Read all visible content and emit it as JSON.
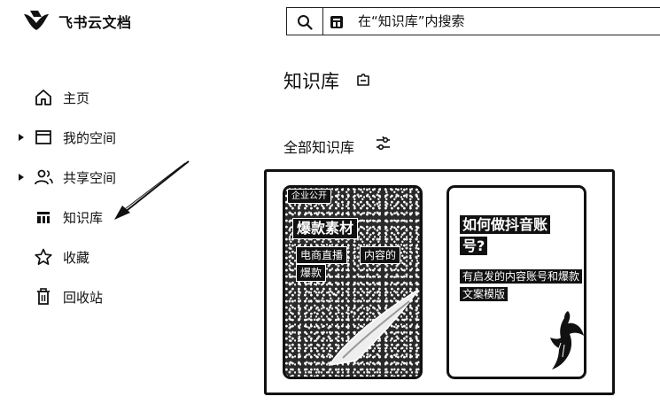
{
  "app": {
    "name": "飞书云文档"
  },
  "search": {
    "placeholder": "在“知识库”内搜索"
  },
  "sidebar": {
    "items": [
      {
        "label": "主页",
        "icon": "home-icon",
        "expandable": false
      },
      {
        "label": "我的空间",
        "icon": "folder-icon",
        "expandable": true
      },
      {
        "label": "共享空间",
        "icon": "people-icon",
        "expandable": true
      },
      {
        "label": "知识库",
        "icon": "wiki-icon",
        "expandable": false
      },
      {
        "label": "收藏",
        "icon": "star-icon",
        "expandable": false
      },
      {
        "label": "回收站",
        "icon": "trash-icon",
        "expandable": false
      }
    ]
  },
  "main": {
    "title": "知识库",
    "section_title": "全部知识库",
    "cards": [
      {
        "tag": "企业公开",
        "title": "爆款素材",
        "pills": [
          "电商直播",
          "内容的",
          "爆款"
        ]
      },
      {
        "title": "如何做抖音账号?",
        "subtitle": "有启发的内容账号和爆款文案模版"
      }
    ]
  },
  "colors": {
    "text": "#111111",
    "background": "#ffffff"
  }
}
